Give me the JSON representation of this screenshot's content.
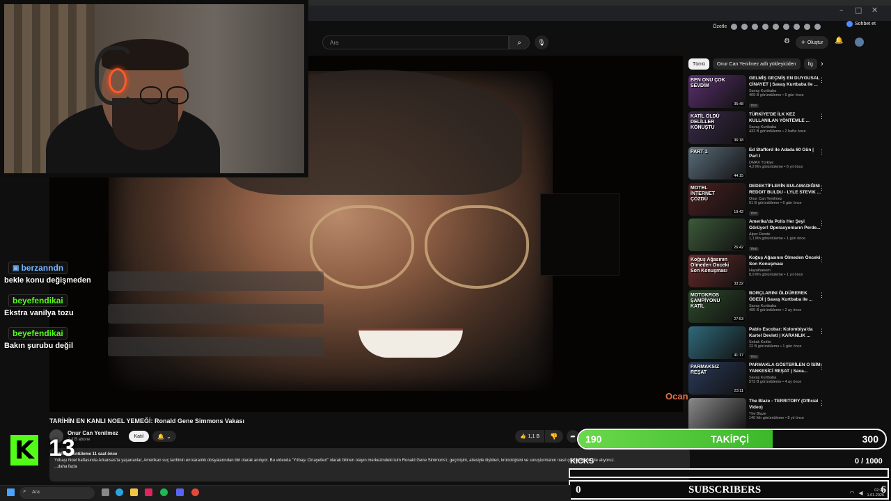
{
  "browser": {
    "summarize_label": "Özetle",
    "chat_label": "Sohbet et",
    "window_controls": [
      "–",
      "□",
      "✕"
    ]
  },
  "yt_header": {
    "search_placeholder": "Ara",
    "create_label": "Oluştur"
  },
  "video": {
    "title": "TARİHİN EN KANLI NOEL YEMEĞİ: Ronald Gene Simmons Vakası",
    "channel": "Onur Can Yenilmez",
    "subscribers": "2,4 B abone",
    "join_label": "Katıl",
    "likes": "1,1 B",
    "views_time": "8.034 görüntüleme  11 saat önce",
    "description": "Yılbaşı Noel haftasında Arkansas'ta yaşananlar, Amerikan suç tarihinin en karanlık dosyalarından biri olarak anılıyor. Bu videoda \"Yılbaşı Cinayetleri\" olarak bilinen olayın merkezindeki isim Ronald Gene Simmons'ı; geçmişini, ailesiyle ilişkileri, kronolojisini ve soruşturmanın nasıl çözüldüğünü ele alıyoruz.",
    "more_label": "...daha fazla",
    "logo_text": "Ocan"
  },
  "chips": [
    "Tümü",
    "Onur Can Yenilmez adlı yükleyiciden",
    "İlg"
  ],
  "recommendations": [
    {
      "thumb_text": "BEN ONU ÇOK SEVDİM",
      "duration": "35:48",
      "title": "GELMİŞ GEÇMİŞ EN DUYGUSAL CİNAYET | Savaş Kurtbaba ile ...",
      "channel": "Savaş Kurtbaba",
      "meta": "409 B görüntüleme • 5 gün önce",
      "badge": "Yeni",
      "color": "#5a2f6e"
    },
    {
      "thumb_text": "KATİL ÖLDÜ DELİLLER KONUŞTU",
      "duration": "36:18",
      "title": "TÜRKİYE'DE İLK KEZ KULLANILAN YÖNTEMLE ...",
      "channel": "Savaş Kurtbaba",
      "meta": "432 B görüntüleme • 2 hafta önce",
      "badge": "",
      "color": "#3b2a4a"
    },
    {
      "thumb_text": "PART 1",
      "duration": "44:15",
      "title": "Ed Stafford ile Adada 60 Gün | Part I",
      "channel": "DMAX Türkiye",
      "meta": "4,2 Mn görüntüleme • 6 yıl önce",
      "badge": "",
      "color": "#5a6d7a"
    },
    {
      "thumb_text": "MOTEL İNTERNET ÇÖZDÜ",
      "duration": "19:42",
      "title": "DEDEKTİFLERİN BULAMADIĞINI REDDIT BULDU - LYLE STEVIK ...",
      "channel": "Onur Can Yenilmez",
      "meta": "51 B görüntüleme • 6 gün önce",
      "badge": "Yeni",
      "color": "#4a1f1f"
    },
    {
      "thumb_text": "",
      "duration": "26:42",
      "title": "Amerika'da Polis Her Şeyi Görüyor! Operasyonların Perde...",
      "channel": "Alper Rende",
      "meta": "1,1 Mn görüntüleme • 1 gün önce",
      "badge": "Yeni",
      "color": "#3d5a3a"
    },
    {
      "thumb_text": "Koğuş Ağasının Ölmeden Önceki Son Konuşması",
      "duration": "33:32",
      "title": "Koğuş Ağasının Ölmeden Önceki Son Konuşması",
      "channel": "Hayalhanem",
      "meta": "8,9 Mn görüntüleme • 1 yıl önce",
      "badge": "",
      "color": "#6a2a2a"
    },
    {
      "thumb_text": "MOTOKROS ŞAMPİYONU KATİL",
      "duration": "27:53",
      "title": "BORÇLARINI ÖLDÜREREK ÖDEDİ | Savaş Kurtbaba ile ...",
      "channel": "Savaş Kurtbaba",
      "meta": "495 B görüntüleme • 2 ay önce",
      "badge": "",
      "color": "#2d4a2a"
    },
    {
      "thumb_text": "",
      "duration": "41:17",
      "title": "Pablo Escobar: Kolombiya'da Kartel Devleti | KARANLIK ...",
      "channel": "Sokak Kedisi",
      "meta": "22 B görüntüleme • 1 gün önce",
      "badge": "Yeni",
      "color": "#2f6a7a"
    },
    {
      "thumb_text": "PARMAKSIZ REŞAT",
      "duration": "23:11",
      "title": "PARMAKLA GÖSTERİLEN O İSİM: YANKESİCİ REŞAT | Sava...",
      "channel": "Savaş Kurtbaba",
      "meta": "573 B görüntüleme • 4 ay önce",
      "badge": "",
      "color": "#2a3a5a"
    },
    {
      "thumb_text": "",
      "duration": "",
      "title": "The Blaze - TERRITORY (Official Video)",
      "channel": "The Blaze",
      "meta": "140 Mn görüntüleme • 8 yıl önce",
      "badge": "",
      "color": "#8a8a8a"
    }
  ],
  "chat": [
    {
      "user": "berzanndn",
      "message": "bekle konu değişmeden",
      "platform": "twitch"
    },
    {
      "user": "beyefendikai",
      "message": "Ekstra vanilya tozu",
      "platform": "kick"
    },
    {
      "user": "beyefendikai",
      "message": "Bakın şurubu değil",
      "platform": "kick"
    }
  ],
  "overlay": {
    "kick_logo": "K",
    "viewer_count": "13",
    "follower_current": "190",
    "follower_label": "TAKİPÇİ",
    "follower_goal": "300",
    "follower_progress": 0.633,
    "kicks_label": "KICKS",
    "kicks_value": "0  / 1000",
    "subs_current": "0",
    "subs_label": "SUBSCRIBERS",
    "subs_goal": "6"
  },
  "taskbar": {
    "search_label": "Ara",
    "time": "02:29",
    "date": "1.01.2026"
  }
}
